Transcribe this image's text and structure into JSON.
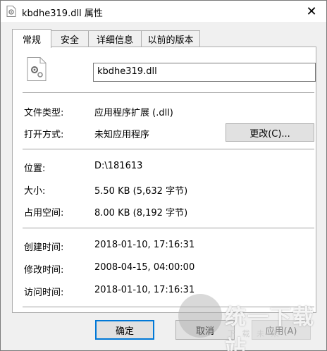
{
  "window": {
    "title": "kbdhe319.dll 属性",
    "close_glyph": "✕"
  },
  "tabs": [
    {
      "label": "常规",
      "active": true
    },
    {
      "label": "安全",
      "active": false
    },
    {
      "label": "详细信息",
      "active": false
    },
    {
      "label": "以前的版本",
      "active": false
    }
  ],
  "general": {
    "file_name": "kbdhe319.dll",
    "file_type_label": "文件类型:",
    "file_type_value": "应用程序扩展 (.dll)",
    "open_with_label": "打开方式:",
    "open_with_value": "未知应用程序",
    "change_button": "更改(C)...",
    "location_label": "位置:",
    "location_value": "D:\\181613",
    "size_label": "大小:",
    "size_value": "5.50 KB (5,632 字节)",
    "size_on_disk_label": "占用空间:",
    "size_on_disk_value": "8.00 KB (8,192 字节)",
    "created_label": "创建时间:",
    "created_value": "‎2018‎-01‎-10, ‏‎17:16:31",
    "modified_label": "修改时间:",
    "modified_value": "‎2008‎-04‎-15, ‏‎04:00:00",
    "accessed_label": "访问时间:",
    "accessed_value": "‎2018‎-01‎-10, ‏‎17:16:31"
  },
  "footer": {
    "ok": "确定",
    "cancel": "取消",
    "apply": "应用(A)"
  },
  "watermark": {
    "text": "统一下载站",
    "sub": "下 载 未 来"
  },
  "colors": {
    "accent": "#0078d7",
    "border": "#adadad"
  }
}
